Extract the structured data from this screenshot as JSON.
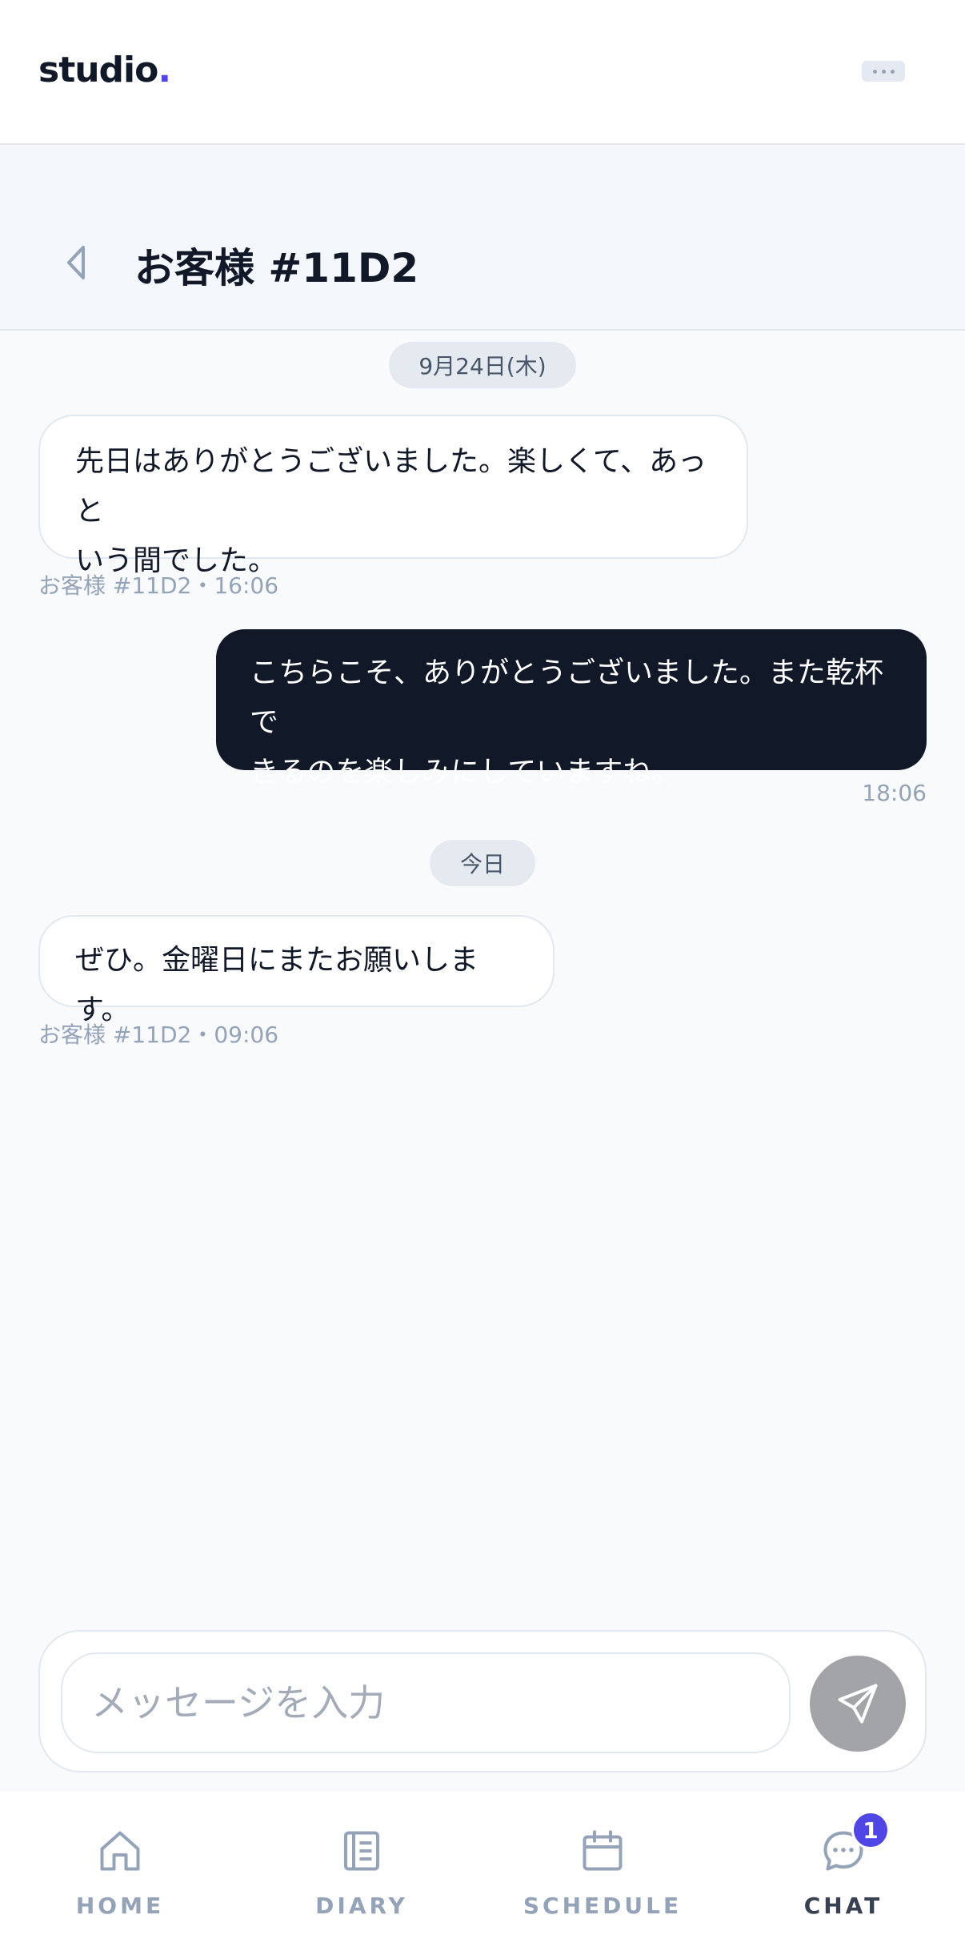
{
  "header": {
    "logo_text": "studio",
    "logo_dot": ".",
    "accent": "#4f46e5"
  },
  "chat": {
    "title": "お客様 #11D2"
  },
  "messages": [
    {
      "date": "9月24日(木)"
    },
    {
      "direction": "incoming",
      "text": [
        "先日はありがとうございました。楽しくて、あっと",
        "いう間でした。"
      ],
      "meta": "お客様 #11D2・16:06"
    },
    {
      "direction": "outgoing",
      "text": [
        "こちらこそ、ありがとうございました。また乾杯で",
        "きるのを楽しみにしていますね。"
      ],
      "meta": "18:06"
    },
    {
      "date": "今日"
    },
    {
      "direction": "incoming",
      "text": [
        "ぜひ。金曜日にまたお願いします。"
      ],
      "meta": "お客様 #11D2・09:06"
    }
  ],
  "composer": {
    "placeholder": "メッセージを入力",
    "value": ""
  },
  "nav": {
    "items": [
      {
        "label": "HOME",
        "icon": "home-icon"
      },
      {
        "label": "DIARY",
        "icon": "diary-icon"
      },
      {
        "label": "SCHEDULE",
        "icon": "calendar-icon"
      },
      {
        "label": "CHAT",
        "icon": "chat-icon",
        "active": true,
        "badge": "1"
      }
    ]
  }
}
